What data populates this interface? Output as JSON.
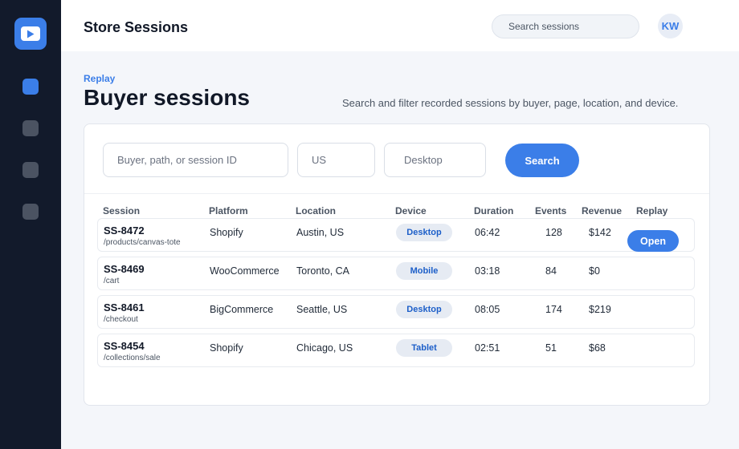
{
  "header": {
    "title": "Store Sessions",
    "search_placeholder": "Search sessions",
    "avatar_initials": "KW"
  },
  "sidebar": {
    "items": [
      {
        "icon": "sessions-nav-icon",
        "active": true
      },
      {
        "icon": "nav-item-icon",
        "active": false
      },
      {
        "icon": "nav-item-icon",
        "active": false
      },
      {
        "icon": "nav-item-icon",
        "active": false
      }
    ]
  },
  "page": {
    "eyebrow": "Replay",
    "title": "Buyer sessions",
    "description": "Search and filter recorded sessions by buyer, page, location, and device."
  },
  "filters": {
    "query_placeholder": "Buyer, path, or session ID",
    "location_placeholder": "US",
    "device_placeholder": "Desktop",
    "search_label": "Search"
  },
  "table": {
    "columns": [
      "Session",
      "Platform",
      "Location",
      "Device",
      "Duration",
      "Events",
      "Revenue",
      "Replay"
    ],
    "rows": [
      {
        "id": "SS-8472",
        "path": "/products/canvas-tote",
        "platform": "Shopify",
        "location": "Austin, US",
        "device": "Desktop",
        "duration": "06:42",
        "events": "128",
        "revenue": "$142",
        "action": "Open"
      },
      {
        "id": "SS-8469",
        "path": "/cart",
        "platform": "WooCommerce",
        "location": "Toronto, CA",
        "device": "Mobile",
        "duration": "03:18",
        "events": "84",
        "revenue": "$0"
      },
      {
        "id": "SS-8461",
        "path": "/checkout",
        "platform": "BigCommerce",
        "location": "Seattle, US",
        "device": "Desktop",
        "duration": "08:05",
        "events": "174",
        "revenue": "$219"
      },
      {
        "id": "SS-8454",
        "path": "/collections/sale",
        "platform": "Shopify",
        "location": "Chicago, US",
        "device": "Tablet",
        "duration": "02:51",
        "events": "51",
        "revenue": "$68"
      }
    ]
  },
  "colors": {
    "accent": "#3b7ee8",
    "sidebar": "#121a2b",
    "badge_bg": "#e6ebf3",
    "badge_text": "#1d5fc9"
  }
}
